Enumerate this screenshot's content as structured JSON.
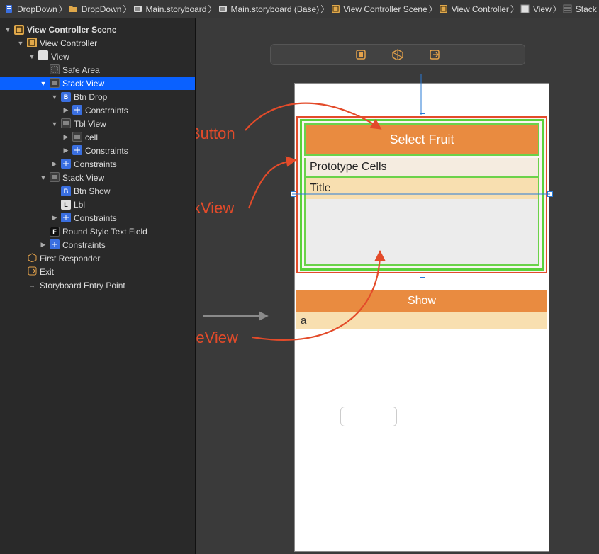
{
  "breadcrumb": [
    {
      "icon": "file-blue",
      "label": "DropDown"
    },
    {
      "icon": "folder",
      "label": "DropDown"
    },
    {
      "icon": "storyboard",
      "label": "Main.storyboard"
    },
    {
      "icon": "storyboard",
      "label": "Main.storyboard (Base)"
    },
    {
      "icon": "scene",
      "label": "View Controller Scene"
    },
    {
      "icon": "scene",
      "label": "View Controller"
    },
    {
      "icon": "view",
      "label": "View"
    },
    {
      "icon": "stack",
      "label": "Stack View"
    }
  ],
  "outline": {
    "header": "View Controller Scene",
    "rows": [
      {
        "indent": 1,
        "tw": "down",
        "icon": "scene",
        "label": "View Controller"
      },
      {
        "indent": 2,
        "tw": "down",
        "icon": "view",
        "label": "View"
      },
      {
        "indent": 3,
        "tw": "",
        "icon": "safe",
        "label": "Safe Area"
      },
      {
        "indent": 3,
        "tw": "down",
        "icon": "stack",
        "label": "Stack View",
        "selected": true
      },
      {
        "indent": 4,
        "tw": "down",
        "icon": "b",
        "label": "Btn Drop"
      },
      {
        "indent": 5,
        "tw": "right",
        "icon": "constr",
        "label": "Constraints"
      },
      {
        "indent": 4,
        "tw": "down",
        "icon": "stack",
        "label": "Tbl View"
      },
      {
        "indent": 5,
        "tw": "right",
        "icon": "stack",
        "label": "cell"
      },
      {
        "indent": 5,
        "tw": "right",
        "icon": "constr",
        "label": "Constraints"
      },
      {
        "indent": 4,
        "tw": "right",
        "icon": "constr",
        "label": "Constraints"
      },
      {
        "indent": 3,
        "tw": "down",
        "icon": "stack",
        "label": "Stack View"
      },
      {
        "indent": 4,
        "tw": "",
        "icon": "b",
        "label": "Btn Show"
      },
      {
        "indent": 4,
        "tw": "",
        "icon": "l",
        "label": "Lbl"
      },
      {
        "indent": 4,
        "tw": "right",
        "icon": "constr",
        "label": "Constraints"
      },
      {
        "indent": 3,
        "tw": "",
        "icon": "f",
        "label": "Round Style Text Field"
      },
      {
        "indent": 3,
        "tw": "right",
        "icon": "constr",
        "label": "Constraints"
      },
      {
        "indent": 1,
        "tw": "",
        "icon": "cube",
        "label": "First Responder"
      },
      {
        "indent": 1,
        "tw": "",
        "icon": "exit",
        "label": "Exit"
      },
      {
        "indent": 1,
        "tw": "",
        "icon": "arrow",
        "label": "Storyboard Entry Point"
      }
    ]
  },
  "canvas": {
    "btn_drop_label": "Select Fruit",
    "prototype_header": "Prototype Cells",
    "prototype_title": "Title",
    "btn_show_label": "Show",
    "lbl_text": "a"
  },
  "annotations": {
    "uibutton": "UIButton",
    "uistackview": "UIStackView",
    "uitableview": "UITableView"
  }
}
